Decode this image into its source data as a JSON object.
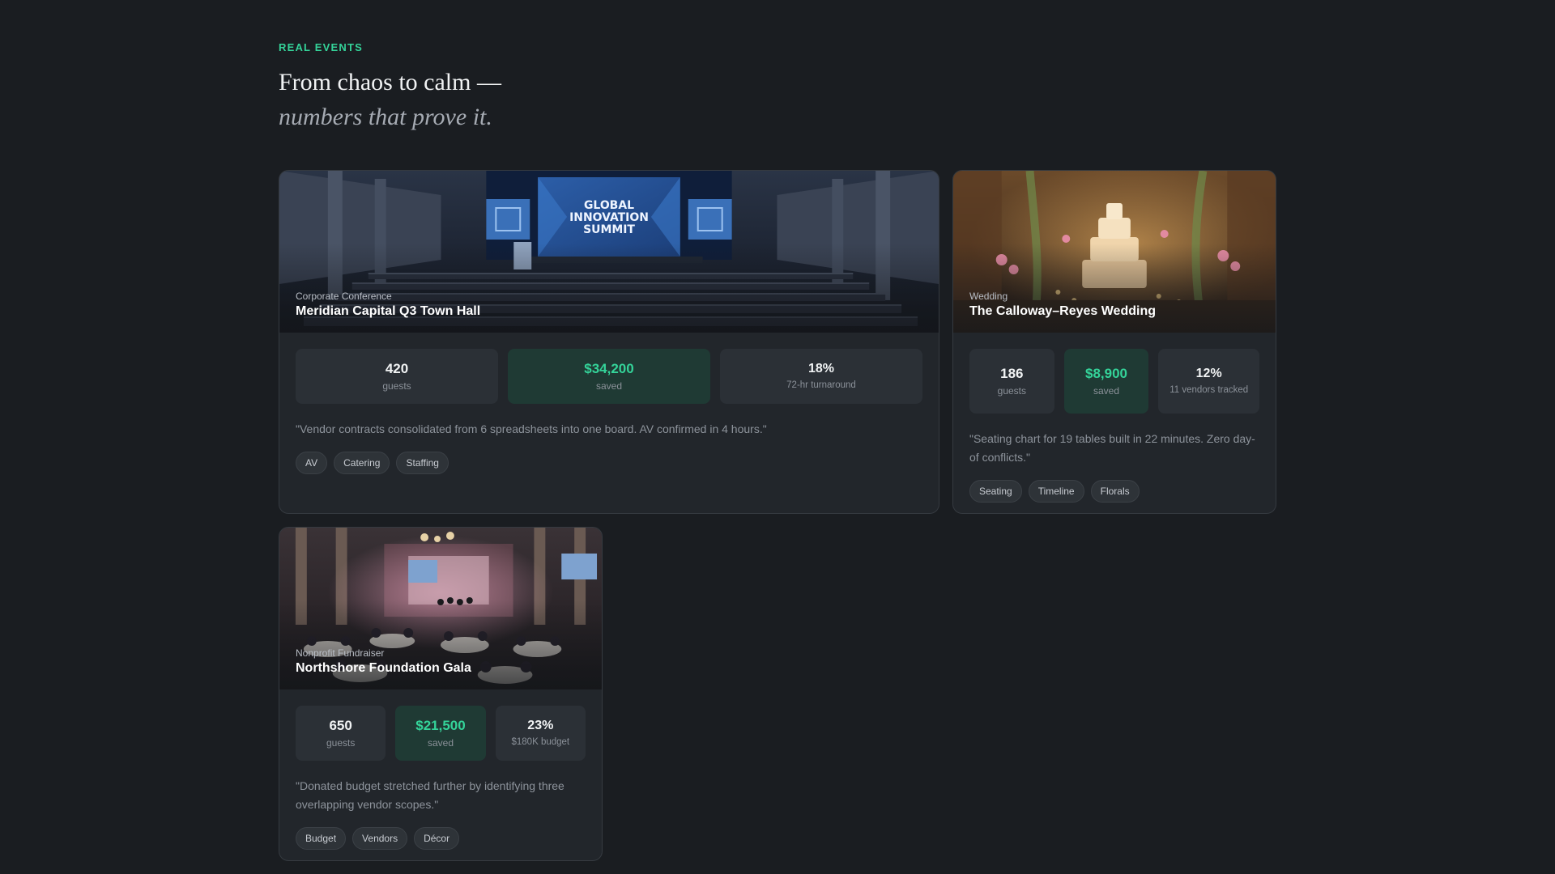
{
  "section": {
    "eyebrow": "REAL EVENTS",
    "headline_line1": "From chaos to calm —",
    "headline_line2": "numbers that prove it."
  },
  "cards": [
    {
      "category": "Corporate Conference",
      "title": "Meridian Capital Q3 Town Hall",
      "image_text": [
        "GLOBAL",
        "INNOVATION",
        "SUMMIT"
      ],
      "stats": [
        {
          "value": "420",
          "label": "guests"
        },
        {
          "value": "$34,200",
          "label": "saved"
        },
        {
          "value": "18%",
          "label": "72-hr turnaround"
        }
      ],
      "quote": "\"Vendor contracts consolidated from 6 spreadsheets into one board. AV confirmed in 4 hours.\"",
      "tags": [
        "AV",
        "Catering",
        "Staffing"
      ]
    },
    {
      "category": "Wedding",
      "title": "The Calloway–Reyes Wedding",
      "stats": [
        {
          "value": "186",
          "label": "guests"
        },
        {
          "value": "$8,900",
          "label": "saved"
        },
        {
          "value": "12%",
          "label": "11 vendors tracked"
        }
      ],
      "quote": "\"Seating chart for 19 tables built in 22 minutes. Zero day-of conflicts.\"",
      "tags": [
        "Seating",
        "Timeline",
        "Florals"
      ]
    },
    {
      "category": "Nonprofit Fundraiser",
      "title": "Northshore Foundation Gala",
      "stats": [
        {
          "value": "650",
          "label": "guests"
        },
        {
          "value": "$21,500",
          "label": "saved"
        },
        {
          "value": "23%",
          "label": "$180K budget"
        }
      ],
      "quote": "\"Donated budget stretched further by identifying three overlapping vendor scopes.\"",
      "tags": [
        "Budget",
        "Vendors",
        "Décor"
      ]
    }
  ]
}
